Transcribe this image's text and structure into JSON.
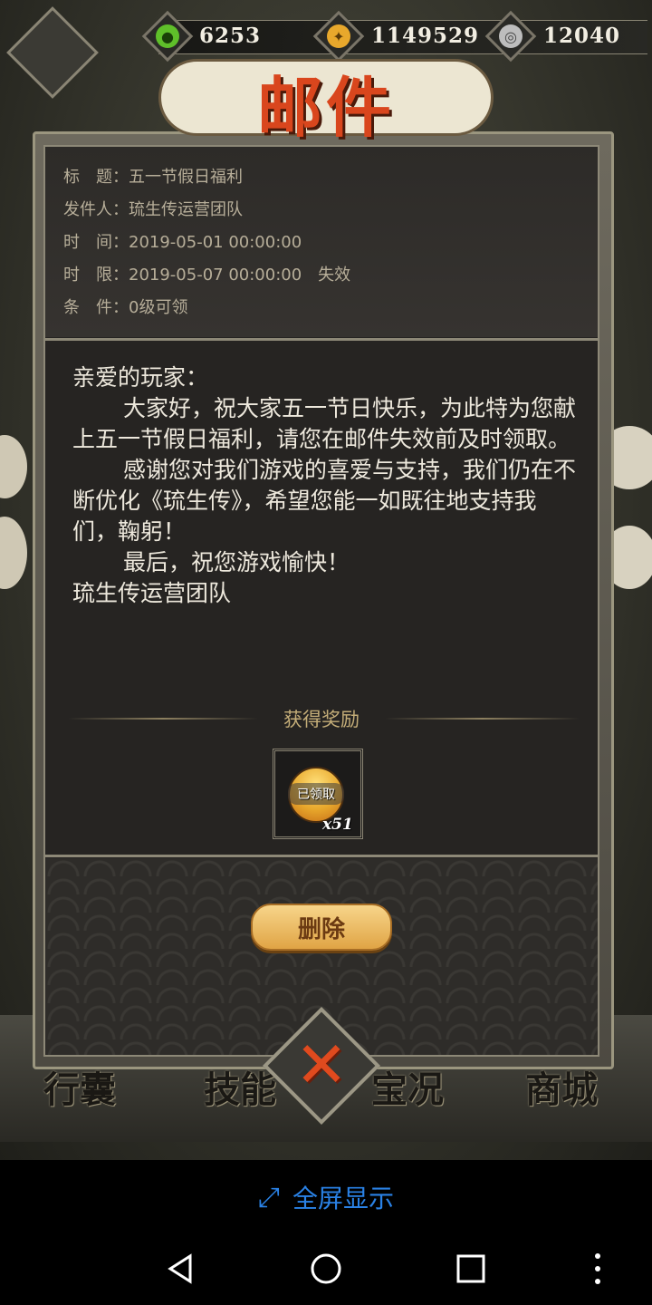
{
  "currencies": [
    {
      "name": "jade",
      "icon": "green-flame-icon",
      "value": "6253",
      "color": "#5fbf2a"
    },
    {
      "name": "gold",
      "icon": "gold-coin-icon",
      "value": "1149529",
      "color": "#e8a82c"
    },
    {
      "name": "silver",
      "icon": "silver-coin-icon",
      "value": "12040",
      "color": "#bdbdbd"
    }
  ],
  "title": "邮件",
  "mail": {
    "fields": [
      {
        "label": "标　题：",
        "value": "五一节假日福利"
      },
      {
        "label": "发件人：",
        "value": "琉生传运营团队"
      },
      {
        "label": "时　间：",
        "value": "2019-05-01 00:00:00"
      },
      {
        "label": "时　限：",
        "value": "2019-05-07 00:00:00　失效"
      },
      {
        "label": "条　件：",
        "value": "0级可领"
      }
    ],
    "greeting": "亲爱的玩家：",
    "paragraphs": [
      "大家好，祝大家五一节日快乐，为此特为您献上五一节假日福利，请您在邮件失效前及时领取。",
      "感谢您对我们游戏的喜爱与支持，我们仍在不断优化《琉生传》，希望您能一如既往地支持我们，鞠躬！",
      "最后，祝您游戏愉快！"
    ],
    "signature": "琉生传运营团队"
  },
  "reward": {
    "section_title": "获得奖励",
    "claimed_label": "已领取",
    "count": "x51"
  },
  "buttons": {
    "delete_label": "删除"
  },
  "bottom_menu": [
    "行囊",
    "技能",
    "宝况",
    "商城"
  ],
  "fullscreen": {
    "label": "全屏显示"
  },
  "colors": {
    "accent_blue": "#2a82e6",
    "title_red": "#d9461d"
  }
}
